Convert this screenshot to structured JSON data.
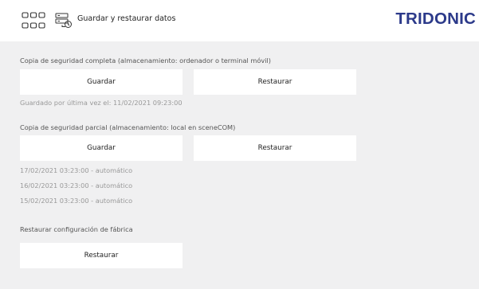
{
  "header": {
    "title": "Guardar y restaurar datos",
    "logo": "TRIDONIC",
    "icons": [
      "apps-grid-icon",
      "backup-restore-icon"
    ],
    "logo_color": "#2c3a8a"
  },
  "full_backup": {
    "label": "Copia de seguridad completa (almacenamiento: ordenador o terminal móvil)",
    "save_label": "Guardar",
    "restore_label": "Restaurar",
    "last_saved": "Guardado por última vez el: 11/02/2021 09:23:00"
  },
  "partial_backup": {
    "label": "Copia de seguridad parcial (almacenamiento: local en sceneCOM)",
    "save_label": "Guardar",
    "restore_label": "Restaurar",
    "entries": [
      "17/02/2021 03:23:00 - automático",
      "16/02/2021 03:23:00 - automático",
      "15/02/2021 03:23:00 - automático"
    ]
  },
  "factory_reset": {
    "label": "Restaurar configuración de fábrica",
    "restore_label": "Restaurar"
  },
  "colors": {
    "background": "#f0f0f1",
    "panel": "#ffffff",
    "muted_text": "#999999"
  }
}
